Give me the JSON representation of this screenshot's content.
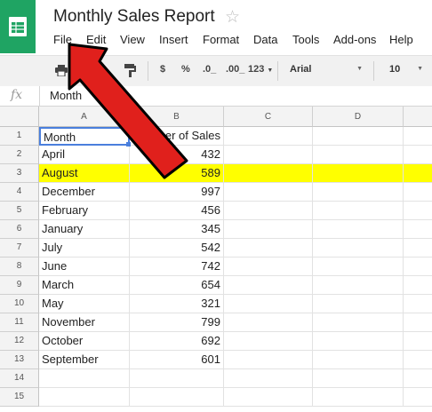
{
  "app": {
    "title": "Monthly Sales Report",
    "star_icon": "star-icon"
  },
  "menu": [
    "File",
    "Edit",
    "View",
    "Insert",
    "Format",
    "Data",
    "Tools",
    "Add-ons",
    "Help"
  ],
  "toolbar": {
    "currency": "$",
    "percent": "%",
    "decrease_decimal": ".0_",
    "increase_decimal": ".00_",
    "more_formats": "123",
    "font": "Arial",
    "font_size": "10"
  },
  "formula_bar": {
    "fx": "fx",
    "value": "Month"
  },
  "columns": [
    "A",
    "B",
    "C",
    "D"
  ],
  "rows": [
    {
      "n": "1",
      "a": "Month",
      "b": "Number of Sales"
    },
    {
      "n": "2",
      "a": "April",
      "b": "432"
    },
    {
      "n": "3",
      "a": "August",
      "b": "589"
    },
    {
      "n": "4",
      "a": "December",
      "b": "997"
    },
    {
      "n": "5",
      "a": "February",
      "b": "456"
    },
    {
      "n": "6",
      "a": "January",
      "b": "345"
    },
    {
      "n": "7",
      "a": "July",
      "b": "542"
    },
    {
      "n": "8",
      "a": "June",
      "b": "742"
    },
    {
      "n": "9",
      "a": "March",
      "b": "654"
    },
    {
      "n": "10",
      "a": "May",
      "b": "321"
    },
    {
      "n": "11",
      "a": "November",
      "b": "799"
    },
    {
      "n": "12",
      "a": "October",
      "b": "692"
    },
    {
      "n": "13",
      "a": "September",
      "b": "601"
    },
    {
      "n": "14",
      "a": "",
      "b": ""
    },
    {
      "n": "15",
      "a": "",
      "b": ""
    }
  ],
  "highlight_row": 3,
  "highlight_color": "#ffff00",
  "annotation": {
    "arrow_color": "#e0201c",
    "target": "File menu"
  }
}
